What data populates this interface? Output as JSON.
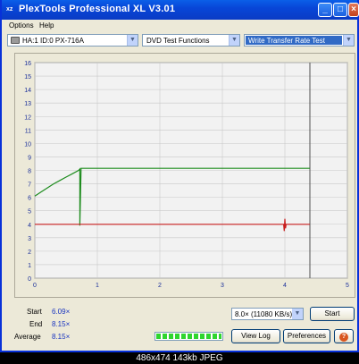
{
  "window": {
    "title": "PlexTools Professional XL V3.01",
    "icon_label": "xz",
    "title_color": "#0846d8"
  },
  "menu": {
    "options": "Options",
    "help": "Help"
  },
  "toolbar": {
    "drive": "HA:1 ID:0 PX-716A",
    "function": "DVD Test Functions",
    "test": "Write Transfer Rate Test"
  },
  "chart_data": {
    "type": "line",
    "x_ticks": [
      "0",
      "1",
      "2",
      "3",
      "4",
      "5"
    ],
    "y_ticks": [
      "0",
      "1",
      "2",
      "3",
      "4",
      "5",
      "6",
      "7",
      "8",
      "9",
      "10",
      "11",
      "12",
      "13",
      "14",
      "15",
      "16"
    ],
    "xlim": [
      0,
      5
    ],
    "ylim": [
      0,
      16
    ],
    "grid": true,
    "marker_x": 4.4,
    "series": [
      {
        "color": "#1e8c1e",
        "x": [
          0,
          0.1,
          0.2,
          0.3,
          0.4,
          0.5,
          0.6,
          0.7,
          0.72,
          0.72,
          0.74,
          1.0,
          2.0,
          3.0,
          4.0,
          4.4
        ],
        "y": [
          6.09,
          6.4,
          6.7,
          7.0,
          7.25,
          7.5,
          7.75,
          8.0,
          8.1,
          3.9,
          8.15,
          8.15,
          8.15,
          8.15,
          8.15,
          8.15
        ]
      },
      {
        "color": "#c81e1e",
        "x": [
          0,
          1.0,
          2.0,
          3.0,
          3.98,
          3.99,
          4.0,
          4.01,
          4.02,
          4.4
        ],
        "y": [
          4.0,
          4.0,
          4.0,
          4.0,
          4.0,
          3.5,
          4.4,
          3.7,
          4.0,
          4.0
        ]
      }
    ]
  },
  "stats": {
    "start_label": "Start",
    "start_value": "6.09×",
    "end_label": "End",
    "end_value": "8.15×",
    "avg_label": "Average",
    "avg_value": "8.15×"
  },
  "controls": {
    "speed": "8.0× (11080 KB/s)",
    "start_button": "Start",
    "view_log_button": "View Log",
    "preferences_button": "Preferences",
    "help_button": "?",
    "progress": 1.0
  },
  "footer": {
    "text": "486x474 143kb JPEG"
  }
}
